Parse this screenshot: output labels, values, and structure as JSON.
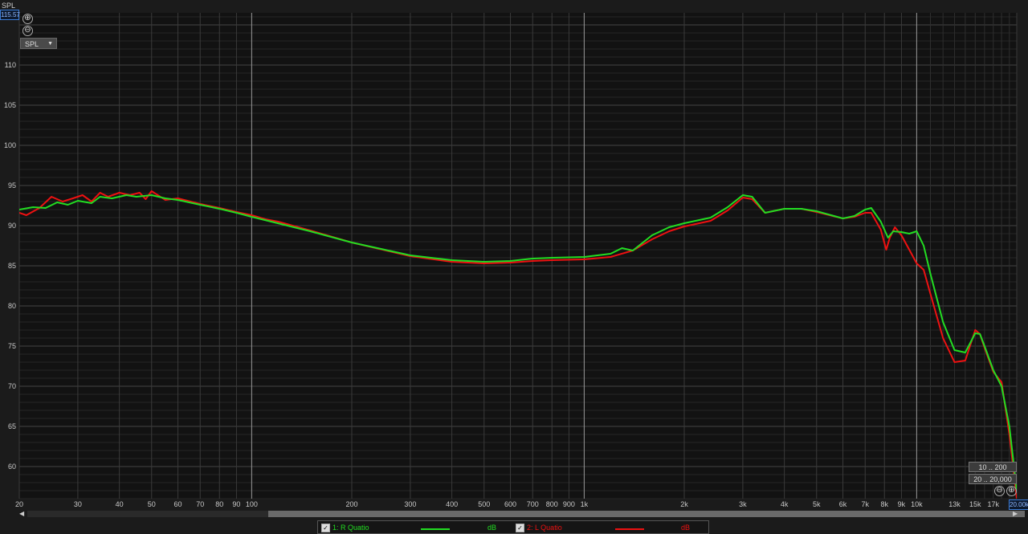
{
  "chart_data": {
    "type": "line",
    "ylabel": "SPL",
    "xlabel": "",
    "x_scale": "log",
    "xlim": [
      20,
      20000
    ],
    "ylim": [
      56,
      116.5
    ],
    "yticks": [
      60,
      65,
      70,
      75,
      80,
      85,
      90,
      95,
      100,
      105,
      110
    ],
    "xticks": [
      {
        "v": 20,
        "label": "20"
      },
      {
        "v": 30,
        "label": "30"
      },
      {
        "v": 40,
        "label": "40"
      },
      {
        "v": 50,
        "label": "50"
      },
      {
        "v": 60,
        "label": "60"
      },
      {
        "v": 70,
        "label": "70"
      },
      {
        "v": 80,
        "label": "80"
      },
      {
        "v": 90,
        "label": "90"
      },
      {
        "v": 100,
        "label": "100"
      },
      {
        "v": 200,
        "label": "200"
      },
      {
        "v": 300,
        "label": "300"
      },
      {
        "v": 400,
        "label": "400"
      },
      {
        "v": 500,
        "label": "500"
      },
      {
        "v": 600,
        "label": "600"
      },
      {
        "v": 700,
        "label": "700"
      },
      {
        "v": 800,
        "label": "800"
      },
      {
        "v": 900,
        "label": "900"
      },
      {
        "v": 1000,
        "label": "1k"
      },
      {
        "v": 2000,
        "label": "2k"
      },
      {
        "v": 3000,
        "label": "3k"
      },
      {
        "v": 4000,
        "label": "4k"
      },
      {
        "v": 5000,
        "label": "5k"
      },
      {
        "v": 6000,
        "label": "6k"
      },
      {
        "v": 7000,
        "label": "7k"
      },
      {
        "v": 8000,
        "label": "8k"
      },
      {
        "v": 9000,
        "label": "9k"
      },
      {
        "v": 10000,
        "label": "10k"
      },
      {
        "v": 13000,
        "label": "13k"
      },
      {
        "v": 15000,
        "label": "15k"
      },
      {
        "v": 17000,
        "label": "17k"
      }
    ],
    "grid": true,
    "series": [
      {
        "name": "1: R Quatio",
        "unit": "dB",
        "color": "#22dd22",
        "points": [
          [
            20,
            92.0
          ],
          [
            22,
            92.3
          ],
          [
            24,
            92.2
          ],
          [
            26,
            92.9
          ],
          [
            28,
            92.6
          ],
          [
            30,
            93.1
          ],
          [
            33,
            92.8
          ],
          [
            35,
            93.6
          ],
          [
            38,
            93.4
          ],
          [
            42,
            93.8
          ],
          [
            45,
            93.6
          ],
          [
            50,
            93.8
          ],
          [
            55,
            93.4
          ],
          [
            60,
            93.2
          ],
          [
            70,
            92.6
          ],
          [
            80,
            92.1
          ],
          [
            90,
            91.6
          ],
          [
            100,
            91.1
          ],
          [
            150,
            89.3
          ],
          [
            200,
            87.9
          ],
          [
            300,
            86.3
          ],
          [
            400,
            85.7
          ],
          [
            500,
            85.5
          ],
          [
            600,
            85.6
          ],
          [
            700,
            85.9
          ],
          [
            800,
            86.0
          ],
          [
            1000,
            86.1
          ],
          [
            1200,
            86.5
          ],
          [
            1300,
            87.2
          ],
          [
            1400,
            86.9
          ],
          [
            1600,
            88.8
          ],
          [
            1800,
            89.8
          ],
          [
            2000,
            90.3
          ],
          [
            2400,
            91.0
          ],
          [
            2700,
            92.3
          ],
          [
            3000,
            93.8
          ],
          [
            3200,
            93.6
          ],
          [
            3500,
            91.6
          ],
          [
            4000,
            92.1
          ],
          [
            4500,
            92.1
          ],
          [
            5000,
            91.8
          ],
          [
            6000,
            90.9
          ],
          [
            6500,
            91.2
          ],
          [
            7000,
            92.0
          ],
          [
            7300,
            92.2
          ],
          [
            7800,
            90.5
          ],
          [
            8200,
            88.5
          ],
          [
            8500,
            89.3
          ],
          [
            9000,
            89.2
          ],
          [
            9500,
            89.0
          ],
          [
            10000,
            89.3
          ],
          [
            10500,
            87.5
          ],
          [
            11000,
            84.0
          ],
          [
            12000,
            78.0
          ],
          [
            13000,
            74.5
          ],
          [
            14000,
            74.2
          ],
          [
            15000,
            76.6
          ],
          [
            15500,
            76.5
          ],
          [
            16000,
            75.0
          ],
          [
            17000,
            72.0
          ],
          [
            18000,
            70.0
          ],
          [
            19000,
            65.0
          ],
          [
            20000,
            57.0
          ]
        ]
      },
      {
        "name": "2: L Quatio",
        "unit": "dB",
        "color": "#ee1111",
        "points": [
          [
            20,
            91.6
          ],
          [
            21,
            91.3
          ],
          [
            23,
            92.2
          ],
          [
            25,
            93.6
          ],
          [
            27,
            93.0
          ],
          [
            29,
            93.4
          ],
          [
            31,
            93.8
          ],
          [
            33,
            93.0
          ],
          [
            35,
            94.1
          ],
          [
            37,
            93.6
          ],
          [
            40,
            94.1
          ],
          [
            43,
            93.8
          ],
          [
            46,
            94.1
          ],
          [
            48,
            93.3
          ],
          [
            50,
            94.3
          ],
          [
            55,
            93.2
          ],
          [
            60,
            93.4
          ],
          [
            70,
            92.7
          ],
          [
            80,
            92.2
          ],
          [
            90,
            91.7
          ],
          [
            100,
            91.3
          ],
          [
            110,
            90.8
          ],
          [
            120,
            90.5
          ],
          [
            150,
            89.4
          ],
          [
            200,
            87.9
          ],
          [
            300,
            86.2
          ],
          [
            400,
            85.5
          ],
          [
            500,
            85.3
          ],
          [
            600,
            85.4
          ],
          [
            700,
            85.6
          ],
          [
            800,
            85.7
          ],
          [
            1000,
            85.8
          ],
          [
            1200,
            86.1
          ],
          [
            1400,
            86.9
          ],
          [
            1600,
            88.3
          ],
          [
            1800,
            89.3
          ],
          [
            2000,
            89.9
          ],
          [
            2400,
            90.6
          ],
          [
            2700,
            91.9
          ],
          [
            3000,
            93.5
          ],
          [
            3200,
            93.3
          ],
          [
            3500,
            91.6
          ],
          [
            4000,
            92.1
          ],
          [
            4500,
            92.1
          ],
          [
            5000,
            91.7
          ],
          [
            6000,
            90.9
          ],
          [
            6500,
            91.1
          ],
          [
            7000,
            91.6
          ],
          [
            7300,
            91.6
          ],
          [
            7800,
            89.5
          ],
          [
            8100,
            87.0
          ],
          [
            8300,
            88.5
          ],
          [
            8600,
            89.8
          ],
          [
            9000,
            88.8
          ],
          [
            9500,
            87.0
          ],
          [
            10000,
            85.3
          ],
          [
            10500,
            84.5
          ],
          [
            11000,
            81.5
          ],
          [
            12000,
            76.0
          ],
          [
            13000,
            73.0
          ],
          [
            14000,
            73.2
          ],
          [
            15000,
            77.0
          ],
          [
            15500,
            76.5
          ],
          [
            16000,
            74.8
          ],
          [
            17000,
            71.8
          ],
          [
            18000,
            70.5
          ],
          [
            19000,
            64.0
          ],
          [
            20000,
            56.0
          ]
        ]
      }
    ]
  },
  "ui": {
    "y_axis_name": "SPL",
    "y_cursor_value": "115.57",
    "mode_select": "SPL",
    "range_btn_1": "10 .. 200",
    "range_btn_2": "20 .. 20,000",
    "x_cursor_value": "20.00k",
    "zoom_in": "⊕",
    "zoom_out": "⊖"
  },
  "legend": [
    {
      "label": "1: R Quatio",
      "unit": "dB",
      "color": "#22dd22"
    },
    {
      "label": "2: L Quatio",
      "unit": "dB",
      "color": "#ee1111"
    }
  ]
}
